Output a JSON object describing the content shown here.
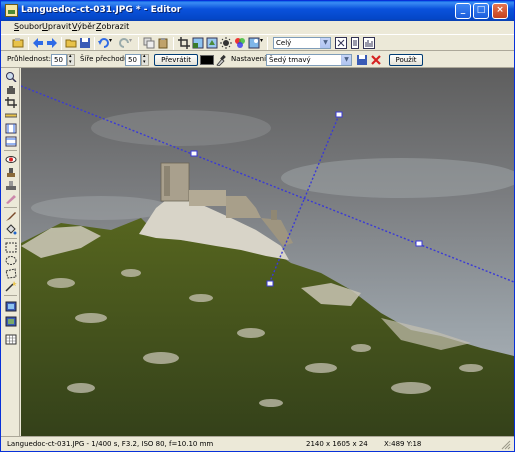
{
  "window": {
    "title": "Languedoc-ct-031.JPG * - Editor"
  },
  "menu": [
    {
      "accel": "S",
      "rest": "oubor"
    },
    {
      "accel": "U",
      "rest": "pravit"
    },
    {
      "accel": "V",
      "rest": "ýběr"
    },
    {
      "accel": "Z",
      "rest": "obrazit"
    }
  ],
  "toolbar": {
    "zoom_value": "Celý",
    "icons": [
      "open-icon",
      "back-icon",
      "forward-icon",
      "folder-icon",
      "save-icon",
      "undo-icon",
      "undo-dropdown-icon",
      "redo-icon",
      "redo-dropdown-icon",
      "copy-icon",
      "paste-icon",
      "crop-tool-icon",
      "resize-icon",
      "rotate-icon",
      "brightness-icon",
      "color-icon",
      "effects-icon",
      "effects-dropdown-icon",
      "fit-window-icon",
      "actual-size-icon",
      "histogram-icon"
    ]
  },
  "propbar": {
    "opacity_label": "Průhlednost:",
    "opacity_value": "50",
    "width_label": "Šíře přechodu:",
    "width_value": "50",
    "reverse_button": "Převrátit",
    "settings_label": "Nastavení:",
    "settings_value": "Šedý tmavý",
    "apply_button": "Použít"
  },
  "tools": [
    "zoom-tool-icon",
    "hand-tool-icon",
    "crop-tool-icon",
    "straighten-tool-icon",
    "horizontal-guide-icon",
    "vertical-guide-icon",
    "red-eye-tool-icon",
    "clone-tool-icon",
    "stamp-tool-icon",
    "retouch-tool-icon",
    "brush-tool-icon",
    "fill-tool-icon",
    "rect-select-icon",
    "ellipse-select-icon",
    "lasso-select-icon",
    "magic-wand-icon",
    "layer-tool-icon",
    "layer-tool-2-icon",
    "grid-tool-icon"
  ],
  "colors": {
    "titlebar": "#0A52DC",
    "sky_top": "#5e5e5e",
    "sky_bottom": "#9aa2a8",
    "vegetation": "#4b5a1c",
    "rock": "#d8d4c8",
    "gradient_line": "#3a3ad6"
  },
  "status": {
    "file_info": "Languedoc-ct-031.JPG - 1/400 s, F3.2, ISO 80, f=10.10 mm",
    "dimensions": "2140 x 1605 x 24",
    "coords": "X:489  Y:18"
  }
}
